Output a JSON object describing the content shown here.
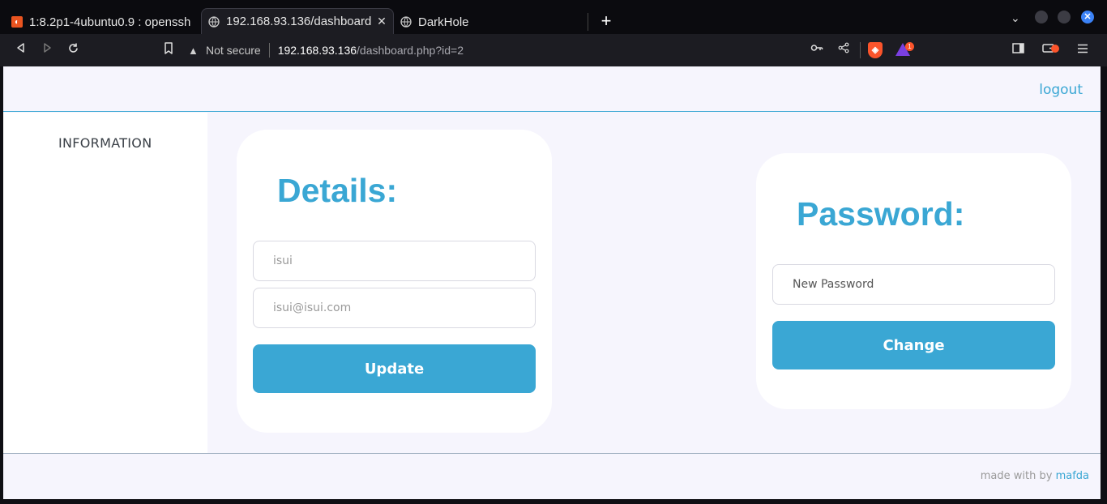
{
  "browser": {
    "tabs": [
      {
        "title": "1:8.2p1-4ubuntu0.9 : openssh",
        "favicon": "ubuntu-icon"
      },
      {
        "title": "192.168.93.136/dashboard",
        "favicon": "globe-icon",
        "close": "✕",
        "active": true
      },
      {
        "title": "DarkHole",
        "favicon": "globe-icon"
      }
    ],
    "new_tab": "+",
    "address": {
      "security": "Not secure",
      "host": "192.168.93.136",
      "path": "/dashboard.php?id=2"
    },
    "rewards_badge": "1"
  },
  "page": {
    "header": {
      "logout": "logout"
    },
    "sidebar": {
      "items": [
        {
          "label": "INFORMATION"
        }
      ]
    },
    "details": {
      "title": "Details:",
      "name_placeholder": "isui",
      "email_placeholder": "isui@isui.com",
      "button": "Update"
    },
    "password": {
      "title": "Password:",
      "new_password_placeholder": "New Password",
      "button": "Change"
    },
    "footer": {
      "prefix": "made with by ",
      "author": "mafda"
    }
  },
  "colors": {
    "accent": "#3aa7d4",
    "page_bg": "#f6f5fd",
    "card_bg": "#ffffff",
    "chrome_bg": "#1c1c22",
    "brave": "#fb542b"
  }
}
